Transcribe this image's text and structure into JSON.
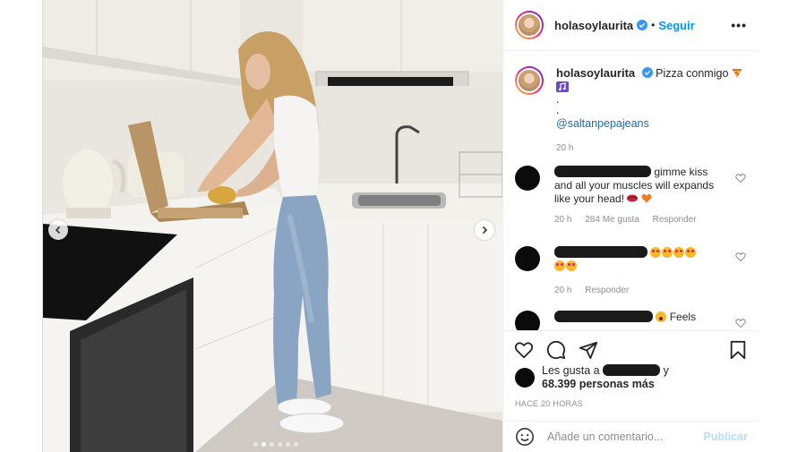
{
  "post": {
    "username": "holasoylaurita",
    "follow_label": "Seguir",
    "separator": "•",
    "more_label": "•••"
  },
  "caption": {
    "username": "holasoylaurita",
    "text": "Pizza conmigo",
    "line2": ".",
    "line3": ".",
    "mention": "@saltanpepajeans",
    "time": "20 h"
  },
  "comments": [
    {
      "text": "gimme kiss and all your muscles will expands like your head!",
      "time": "20 h",
      "likes": "284 Me gusta",
      "reply_label": "Responder"
    },
    {
      "text": "",
      "time": "20 h",
      "reply_label": "Responder"
    },
    {
      "text": "Feels"
    }
  ],
  "likes": {
    "prefix": "Les gusta a",
    "suffix": "y",
    "count": "68.399 personas más"
  },
  "timestamp": "HACE 20 HORAS",
  "add_comment": {
    "placeholder": "Añade un comentario...",
    "publish_label": "Publicar"
  },
  "carousel": {
    "count": 6,
    "active_index": 1
  },
  "colors": {
    "link": "#0095f6",
    "publish_disabled": "#b2dffc",
    "meta": "#8e8e8e",
    "border": "#dbdbdb"
  },
  "icons": [
    "verified-icon",
    "heart-icon",
    "comment-icon",
    "share-icon",
    "bookmark-icon",
    "emoji-icon",
    "chevron-left-icon",
    "chevron-right-icon"
  ]
}
